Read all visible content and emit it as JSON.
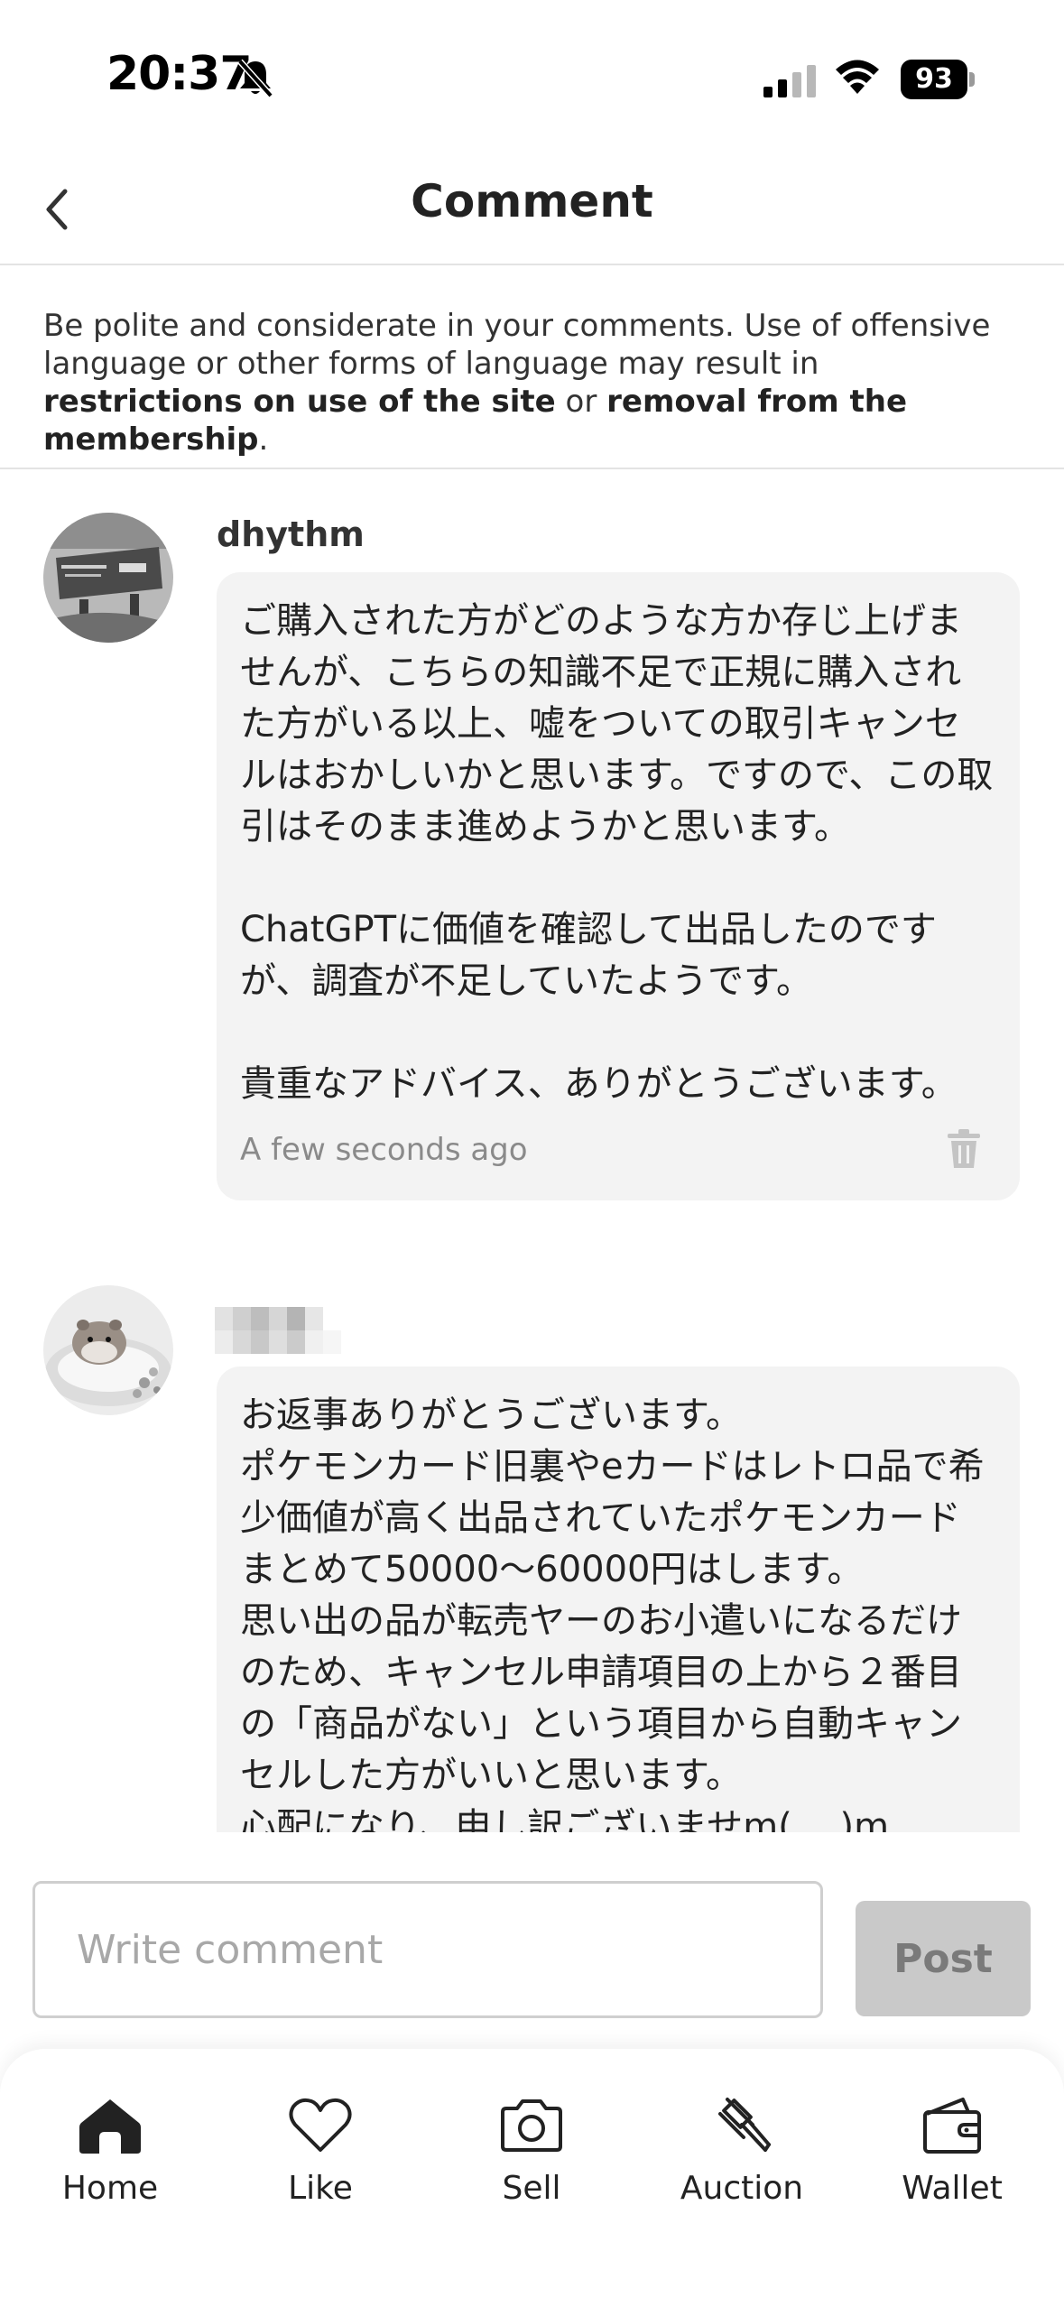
{
  "status_bar": {
    "time": "20:37",
    "battery": "93"
  },
  "header": {
    "title": "Comment"
  },
  "notice": {
    "text_1": "Be polite and considerate in your comments. Use of offensive language or other forms of language may result in ",
    "bold_1": "restrictions on use of the site",
    "text_2": " or ",
    "bold_2": "removal from the membership",
    "text_3": "."
  },
  "comments": [
    {
      "username": "dhythm",
      "text": "ご購入された方がどのような方か存じ上げませんが、こちらの知識不足で正規に購入された方がいる以上、嘘をついての取引キャンセルはおかしいかと思います。ですので、この取引はそのまま進めようかと思います。\n\nChatGPTに価値を確認して出品したのですが、調査が不足していたようです。\n\n貴重なアドバイス、ありがとうございます。",
      "timestamp": "A few seconds ago"
    },
    {
      "username": "",
      "text": "お返事ありがとうございます。\nポケモンカード旧裏やeカードはレトロ品で希少価値が高く出品されていたポケモンカードまとめて50000〜60000円はします。\n思い出の品が転売ヤーのお小遣いになるだけのため、キャンセル申請項目の上から２番目の「商品がない」という項目から自動キャンセルした方がいいと思います。\n心配になり、申し訳ございませm(_ _)m"
    }
  ],
  "composer": {
    "placeholder": "Write comment",
    "value": "",
    "post_label": "Post"
  },
  "tabbar": {
    "items": [
      {
        "label": "Home",
        "icon": "home-icon"
      },
      {
        "label": "Like",
        "icon": "heart-icon"
      },
      {
        "label": "Sell",
        "icon": "camera-icon"
      },
      {
        "label": "Auction",
        "icon": "gavel-icon"
      },
      {
        "label": "Wallet",
        "icon": "wallet-icon"
      }
    ]
  }
}
